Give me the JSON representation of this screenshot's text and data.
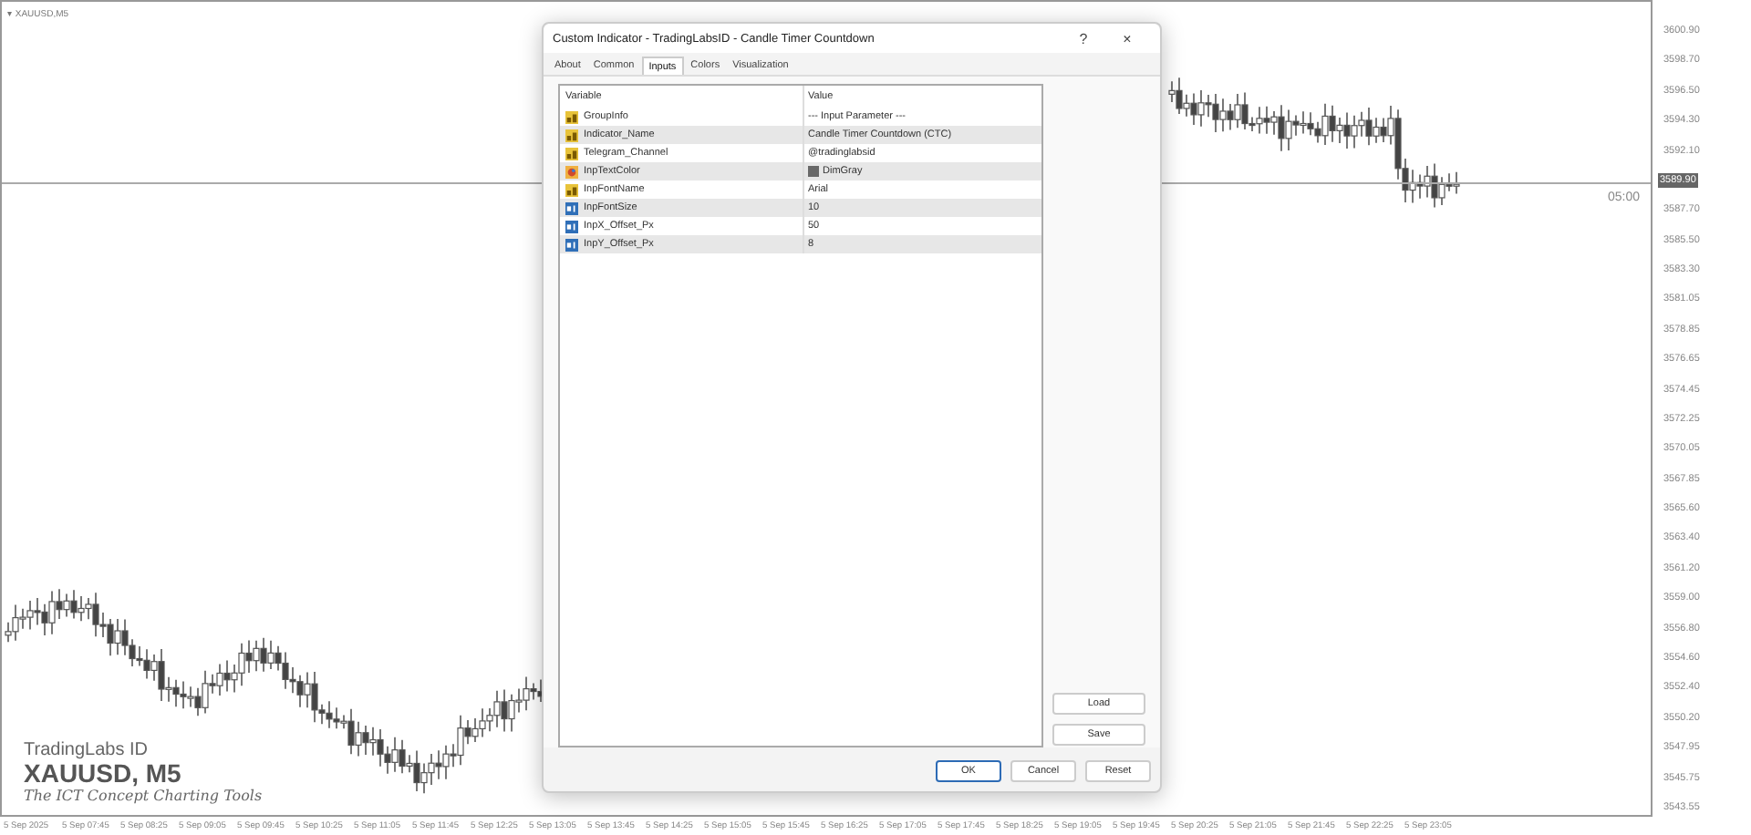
{
  "chart": {
    "menu_glyph": "▾",
    "title": "XAUUSD,M5",
    "timer": "05:00",
    "price_labels": [
      {
        "text": "3600.90",
        "current": false
      },
      {
        "text": "3598.70",
        "current": false
      },
      {
        "text": "3596.50",
        "current": false
      },
      {
        "text": "3594.30",
        "current": false
      },
      {
        "text": "3592.10",
        "current": false
      },
      {
        "text": "3589.90",
        "current": true
      },
      {
        "text": "3587.70",
        "current": false
      },
      {
        "text": "3585.50",
        "current": false
      },
      {
        "text": "3583.30",
        "current": false
      },
      {
        "text": "3581.05",
        "current": false
      },
      {
        "text": "3578.85",
        "current": false
      },
      {
        "text": "3576.65",
        "current": false
      },
      {
        "text": "3574.45",
        "current": false
      },
      {
        "text": "3572.25",
        "current": false
      },
      {
        "text": "3570.05",
        "current": false
      },
      {
        "text": "3567.85",
        "current": false
      },
      {
        "text": "3565.60",
        "current": false
      },
      {
        "text": "3563.40",
        "current": false
      },
      {
        "text": "3561.20",
        "current": false
      },
      {
        "text": "3559.00",
        "current": false
      },
      {
        "text": "3556.80",
        "current": false
      },
      {
        "text": "3554.60",
        "current": false
      },
      {
        "text": "3552.40",
        "current": false
      },
      {
        "text": "3550.20",
        "current": false
      },
      {
        "text": "3547.95",
        "current": false
      },
      {
        "text": "3545.75",
        "current": false
      },
      {
        "text": "3543.55",
        "current": false
      }
    ],
    "time_labels": [
      "5 Sep 2025",
      "5 Sep 07:45",
      "5 Sep 08:25",
      "5 Sep 09:05",
      "5 Sep 09:45",
      "5 Sep 10:25",
      "5 Sep 11:05",
      "5 Sep 11:45",
      "5 Sep 12:25",
      "5 Sep 13:05",
      "5 Sep 13:45",
      "5 Sep 14:25",
      "5 Sep 15:05",
      "5 Sep 15:45",
      "5 Sep 16:25",
      "5 Sep 17:05",
      "5 Sep 17:45",
      "5 Sep 18:25",
      "5 Sep 19:05",
      "5 Sep 19:45",
      "5 Sep 20:25",
      "5 Sep 21:05",
      "5 Sep 21:45",
      "5 Sep 22:25",
      "5 Sep 23:05"
    ],
    "overlay": {
      "brand": "TradingLabs ID",
      "symbol": "XAUUSD, M5",
      "tagline": "The ICT Concept Charting Tools"
    }
  },
  "dialog": {
    "title": "Custom Indicator - TradingLabsID - Candle Timer Countdown",
    "help": "?",
    "close": "×",
    "tabs": [
      {
        "label": "About",
        "selected": false
      },
      {
        "label": "Common",
        "selected": false
      },
      {
        "label": "Inputs",
        "selected": true
      },
      {
        "label": "Colors",
        "selected": false
      },
      {
        "label": "Visualization",
        "selected": false
      }
    ],
    "columns": [
      "Variable",
      "Value"
    ],
    "rows": [
      {
        "kind": "string",
        "variable": "GroupInfo",
        "value": "--- Input Parameter ---"
      },
      {
        "kind": "string",
        "variable": "Indicator_Name",
        "value": "Candle Timer Countdown (CTC)"
      },
      {
        "kind": "string",
        "variable": "Telegram_Channel",
        "value": "@tradinglabsid"
      },
      {
        "kind": "color",
        "variable": "InpTextColor",
        "value": "DimGray",
        "color": "#696969"
      },
      {
        "kind": "string",
        "variable": "InpFontName",
        "value": "Arial"
      },
      {
        "kind": "number",
        "variable": "InpFontSize",
        "value": "10"
      },
      {
        "kind": "number",
        "variable": "InpX_Offset_Px",
        "value": "50"
      },
      {
        "kind": "number",
        "variable": "InpY_Offset_Px",
        "value": "8"
      }
    ],
    "side_buttons": [
      "Load",
      "Save"
    ],
    "buttons": [
      {
        "label": "OK",
        "default": true
      },
      {
        "label": "Cancel",
        "default": false
      },
      {
        "label": "Reset",
        "default": false
      }
    ]
  }
}
